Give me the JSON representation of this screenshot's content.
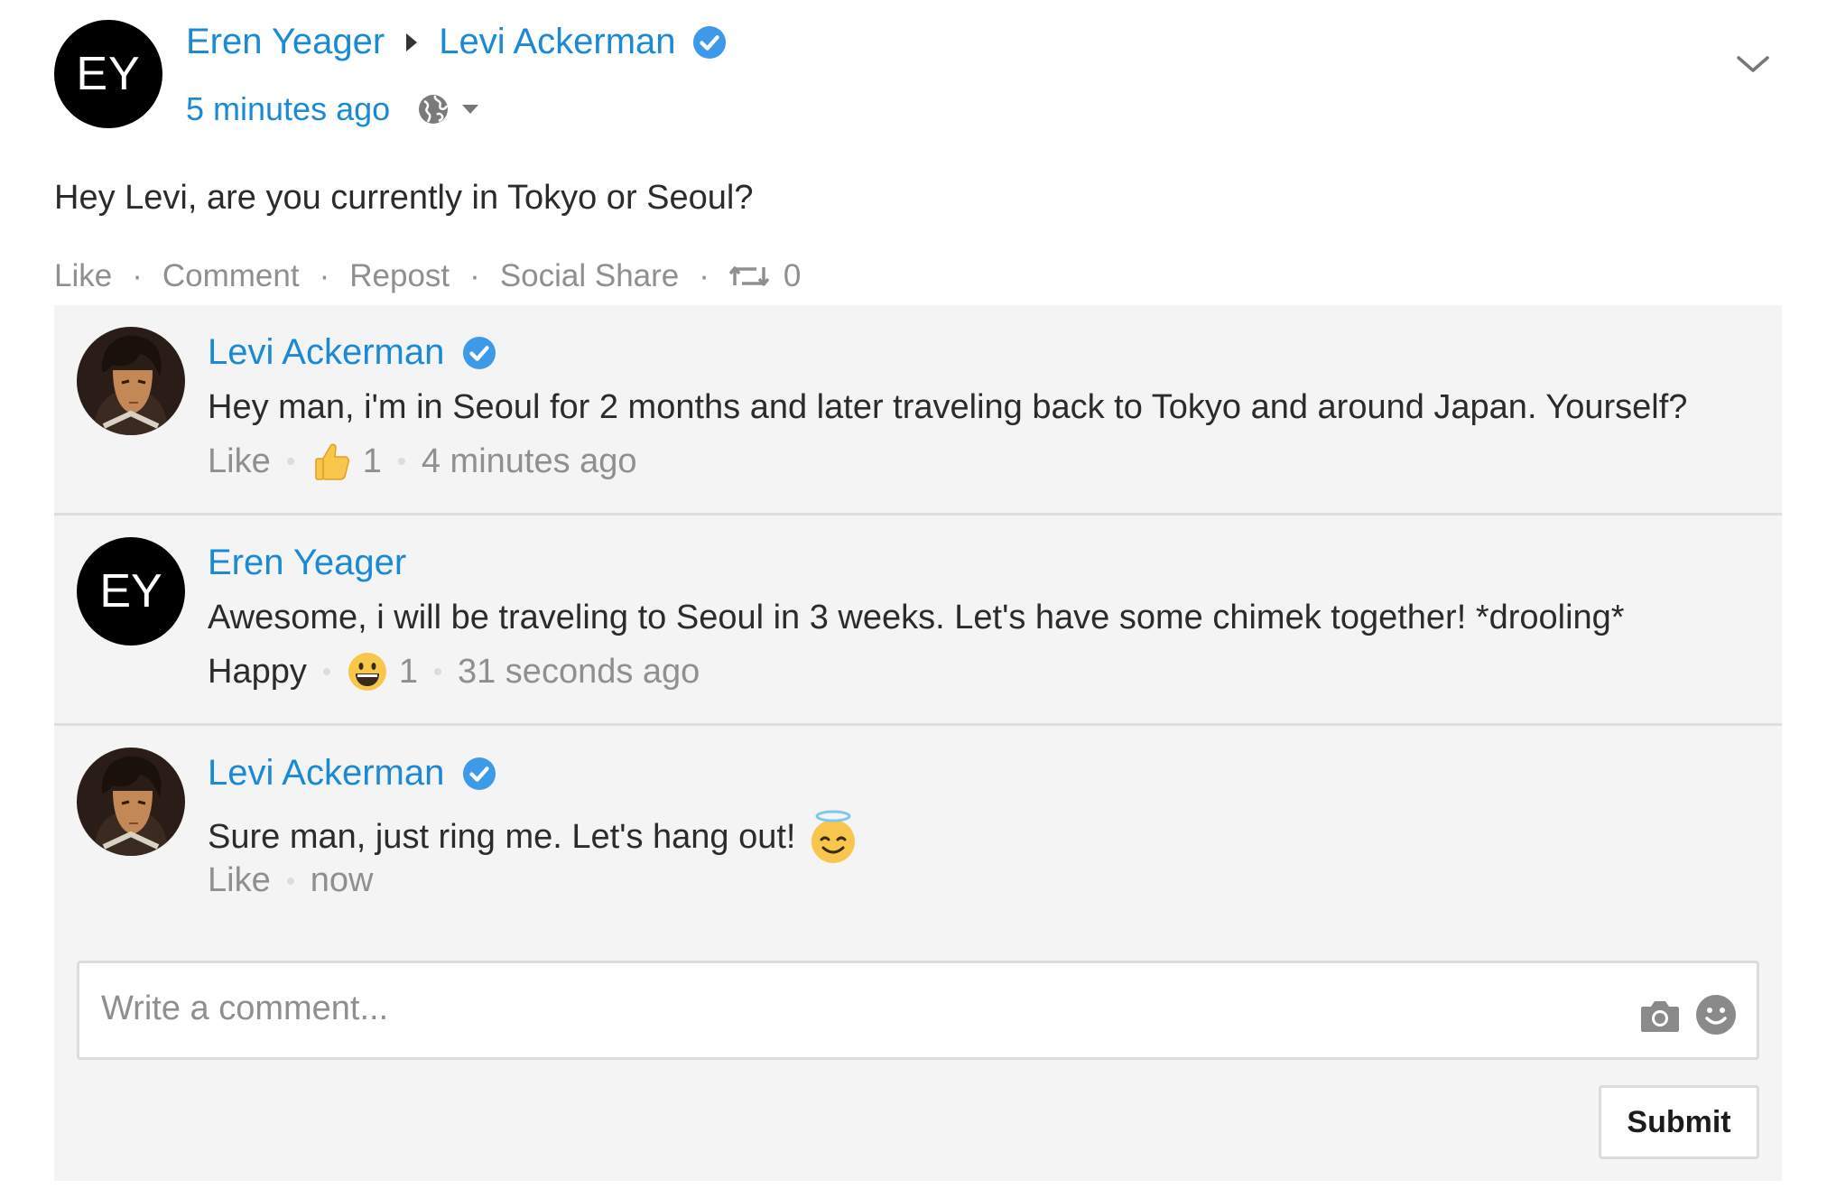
{
  "post": {
    "avatar_initials": "EY",
    "author": "Eren Yeager",
    "recipient": "Levi Ackerman",
    "time": "5 minutes ago",
    "text": "Hey Levi, are you currently in Tokyo or Seoul?",
    "actions": {
      "like": "Like",
      "comment": "Comment",
      "repost": "Repost",
      "social_share": "Social Share",
      "repost_count": "0",
      "separator": "·"
    }
  },
  "comments": [
    {
      "author": "Levi Ackerman",
      "verified": true,
      "text": "Hey man, i'm in Seoul for 2 months and later traveling back to Tokyo and around Japan. Yourself?",
      "reaction_label": "Like",
      "reaction_icon": "thumbs-up-icon",
      "reaction_count": "1",
      "time": "4 minutes ago"
    },
    {
      "author": "Eren Yeager",
      "avatar_initials": "EY",
      "verified": false,
      "text": "Awesome, i will be traveling to Seoul in 3 weeks. Let's have some chimek together! *drooling*",
      "reaction_label": "Happy",
      "reaction_icon": "grinning-face-icon",
      "reaction_count": "1",
      "time": "31 seconds ago"
    },
    {
      "author": "Levi Ackerman",
      "verified": true,
      "text": "Sure man, just ring me. Let's hang out!",
      "text_emoji": "smiling-face-with-halo-icon",
      "reaction_label": "Like",
      "time": "now"
    }
  ],
  "comment_box": {
    "placeholder": "Write a comment...",
    "submit_label": "Submit"
  },
  "colors": {
    "link_blue": "#1a8ad4",
    "verified_blue": "#3d9ae8",
    "panel_bg": "#f4f4f4",
    "muted_text": "#8f8f8f"
  }
}
